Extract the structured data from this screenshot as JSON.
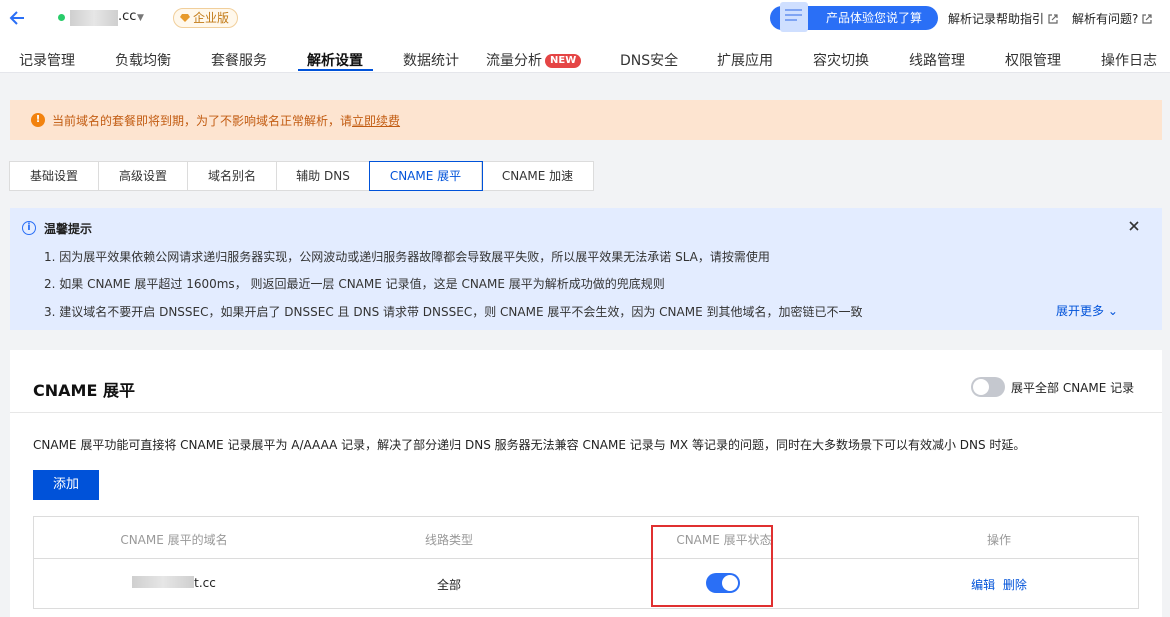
{
  "header": {
    "domain_suffix": ".cc",
    "edition": "企业版",
    "feedback_label": "产品体验您说了算",
    "help_link": "解析记录帮助指引",
    "question_link": "解析有问题?"
  },
  "main_tabs": [
    "记录管理",
    "负载均衡",
    "套餐服务",
    "解析设置",
    "数据统计",
    "流量分析",
    "DNS安全",
    "扩展应用",
    "容灾切换",
    "线路管理",
    "权限管理",
    "操作日志"
  ],
  "main_tabs_active": "解析设置",
  "new_badge": "NEW",
  "alert": {
    "text": "当前域名的套餐即将到期，为了不影响域名正常解析，请",
    "link": "立即续费"
  },
  "sub_tabs": [
    "基础设置",
    "高级设置",
    "域名别名",
    "辅助 DNS",
    "CNAME 展平",
    "CNAME 加速"
  ],
  "sub_tabs_active": "CNAME 展平",
  "tips": {
    "title": "温馨提示",
    "lines": [
      "1. 因为展平效果依赖公网请求递归服务器实现，公网波动或递归服务器故障都会导致展平失败，所以展平效果无法承诺 SLA，请按需使用",
      "2. 如果 CNAME 展平超过 1600ms， 则返回最近一层 CNAME 记录值，这是 CNAME 展平为解析成功做的兜底规则",
      "3. 建议域名不要开启 DNSSEC，如果开启了 DNSSEC 且 DNS 请求带 DNSSEC，则 CNAME 展平不会生效，因为 CNAME 到其他域名，加密链已不一致"
    ],
    "more": "展开更多"
  },
  "card": {
    "title": "CNAME 展平",
    "toggle_all_label": "展平全部 CNAME 记录",
    "toggle_all_on": false,
    "description": "CNAME 展平功能可直接将 CNAME 记录展平为 A/AAAA 记录，解决了部分递归 DNS 服务器无法兼容 CNAME 记录与 MX 等记录的问题，同时在大多数场景下可以有效减小 DNS 时延。",
    "add_label": "添加"
  },
  "table": {
    "columns": [
      "CNAME 展平的域名",
      "线路类型",
      "CNAME 展平状态",
      "操作"
    ],
    "rows": [
      {
        "domain_suffix": "t.cc",
        "line": "全部",
        "enabled": true,
        "edit": "编辑",
        "delete": "删除"
      }
    ]
  },
  "colors": {
    "primary": "#0052d9",
    "toggle_on": "#2a6ff6",
    "alert_bg": "#fde4d0",
    "tips_bg": "#e3ecff",
    "highlight": "#e03030"
  }
}
